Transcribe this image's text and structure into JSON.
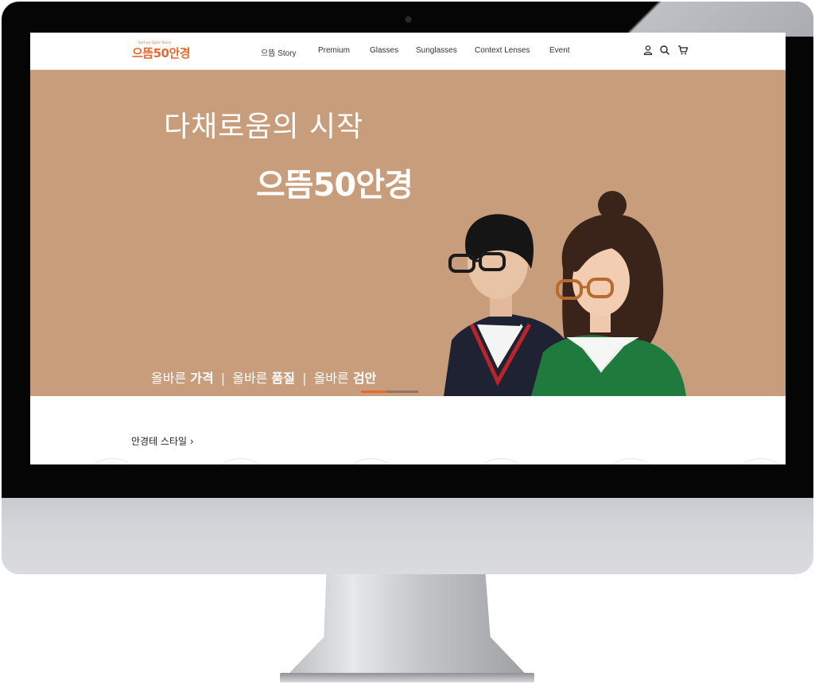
{
  "brand": {
    "logo_tagline": "Self-on Optic Store",
    "logo_name": "으뜸50안경",
    "accent_color": "#e8692e",
    "hero_bg_color": "#c89d7c"
  },
  "nav": {
    "items": [
      {
        "label": "으뜸 Story"
      },
      {
        "label": "Premium"
      },
      {
        "label": "Glasses"
      },
      {
        "label": "Sunglasses"
      },
      {
        "label": "Context Lenses"
      },
      {
        "label": "Event"
      }
    ]
  },
  "header_icons": [
    "user-icon",
    "search-icon",
    "cart-icon"
  ],
  "hero": {
    "line1": "다채로움의 시작",
    "line2": "으뜸50안경",
    "tagline": [
      {
        "prefix": "올바른 ",
        "bold": "가격"
      },
      {
        "prefix": "올바른 ",
        "bold": "품질"
      },
      {
        "prefix": "올바른 ",
        "bold": "검안"
      }
    ],
    "tagline_separator": "|",
    "slide_progress": 0.45
  },
  "style_section": {
    "title": "안경테 스타일",
    "chevron": "›"
  }
}
